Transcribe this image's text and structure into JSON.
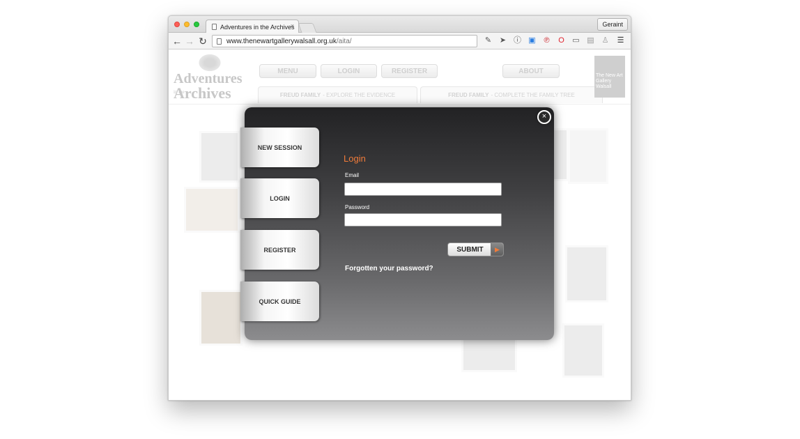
{
  "browser": {
    "tab_title": "Adventures in the Archives",
    "tab_close": "×",
    "profile_name": "Geraint",
    "url_domain": "www.thenewartgallerywalsall.org.uk",
    "url_path": "/aita/",
    "nav": {
      "back": "←",
      "forward": "→",
      "reload": "↻"
    },
    "extensions": [
      "eyedropper-icon",
      "cursor-icon",
      "info-icon",
      "window-icon",
      "pinterest-icon",
      "opera-icon",
      "cast-icon",
      "layers-icon",
      "person-icon",
      "menu-icon"
    ]
  },
  "site": {
    "logo": {
      "line1": "Adventures",
      "line2": "in the",
      "line3": "Archives"
    },
    "header_buttons": {
      "menu": "MENU",
      "login": "LOGIN",
      "register": "REGISTER",
      "about": "ABOUT"
    },
    "header_tabs": [
      {
        "bold": "FREUD FAMILY",
        "rest": "- EXPLORE THE EVIDENCE"
      },
      {
        "bold": "FREUD FAMILY",
        "rest": "- COMPLETE THE FAMILY TREE"
      }
    ],
    "gallery_logo": "The New Art Gallery Walsall"
  },
  "modal": {
    "side_tabs": [
      "NEW SESSION",
      "LOGIN",
      "REGISTER",
      "QUICK GUIDE"
    ],
    "title": "Login",
    "email_label": "Email",
    "email_value": "",
    "password_label": "Password",
    "password_value": "",
    "submit_label": "SUBMIT",
    "forgot_label": "Forgotten your password?",
    "close_glyph": "×",
    "accent_color": "#f07b3a"
  }
}
